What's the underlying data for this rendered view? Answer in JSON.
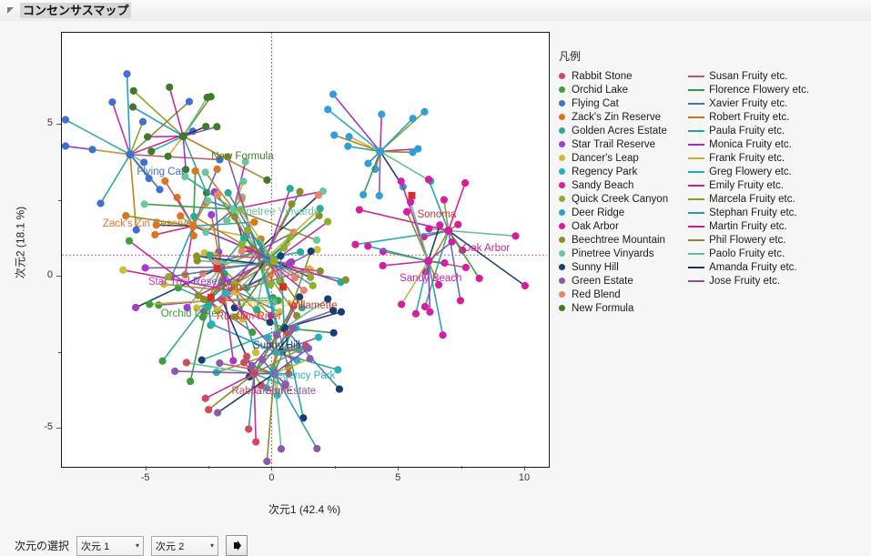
{
  "window": {
    "title": "コンセンサスマップ",
    "disclosure_icon": "triangle-collapse-icon"
  },
  "legend": {
    "title": "凡例",
    "products": [
      {
        "label": "Rabbit Stone",
        "color": "#cf4a5c"
      },
      {
        "label": "Orchid Lake",
        "color": "#3d9e3d"
      },
      {
        "label": "Flying Cat",
        "color": "#3f6fd0"
      },
      {
        "label": "Zack's Zin Reserve",
        "color": "#d9761f"
      },
      {
        "label": "Golden Acres Estate",
        "color": "#2aab94"
      },
      {
        "label": "Star Trail Reserve",
        "color": "#a23bd1"
      },
      {
        "label": "Dancer's Leap",
        "color": "#cdbb3c"
      },
      {
        "label": "Regency Park",
        "color": "#26b0be"
      },
      {
        "label": "Sandy Beach",
        "color": "#d51ea8"
      },
      {
        "label": "Quick Creek Canyon",
        "color": "#8fae2b"
      },
      {
        "label": "Deer Ridge",
        "color": "#2f9fd6"
      },
      {
        "label": "Oak Arbor",
        "color": "#d61e9b"
      },
      {
        "label": "Beechtree Mountain",
        "color": "#8a8f27"
      },
      {
        "label": "Pinetree Vinyards",
        "color": "#68c79c"
      },
      {
        "label": "Sunny Hill",
        "color": "#153f72"
      },
      {
        "label": "Green Estate",
        "color": "#8a5ba8"
      },
      {
        "label": "Red Blend",
        "color": "#e8866c"
      },
      {
        "label": "New Formula",
        "color": "#3f7a29"
      }
    ],
    "attributes": [
      {
        "label": "Susan Fruity etc.",
        "color": "#c0566a"
      },
      {
        "label": "Florence Flowery etc.",
        "color": "#2e9b3f"
      },
      {
        "label": "Xavier Fruity etc.",
        "color": "#4472b8"
      },
      {
        "label": "Robert Fruity etc.",
        "color": "#c07a1e"
      },
      {
        "label": "Paula Fruity etc.",
        "color": "#22a692"
      },
      {
        "label": "Monica Fruity etc.",
        "color": "#9b2fc7"
      },
      {
        "label": "Frank Fruity etc.",
        "color": "#c2b032"
      },
      {
        "label": "Greg Flowery etc.",
        "color": "#1fa9b4"
      },
      {
        "label": "Emily Fruity etc.",
        "color": "#c820a0"
      },
      {
        "label": "Marcela Fruity etc.",
        "color": "#8a9c22"
      },
      {
        "label": "Stephan Fruity etc.",
        "color": "#2296c4"
      },
      {
        "label": "Martin Fruity etc.",
        "color": "#cc1f92"
      },
      {
        "label": "Phil Flowery etc.",
        "color": "#7f8a25"
      },
      {
        "label": "Paolo Fruity etc.",
        "color": "#5cbf95"
      },
      {
        "label": "Amanda Fruity etc.",
        "color": "#16365f"
      },
      {
        "label": "Jose Fruity etc.",
        "color": "#7f53a0"
      }
    ]
  },
  "controls": {
    "label": "次元の選択",
    "dim1": "次元 1",
    "dim2": "次元 2",
    "chevron": "▼",
    "go_button_icon": "right-arrow-icon"
  },
  "chart_data": {
    "type": "scatter",
    "title": "コンセンサスマップ",
    "xlabel": "次元1  (42.4 %)",
    "ylabel": "次元2  (18.1 %)",
    "xticks": [
      -5,
      0,
      5,
      10
    ],
    "yticks": [
      5,
      0,
      -5
    ],
    "xlim": [
      -8.3,
      10.9
    ],
    "ylim": [
      -6.9,
      7.3
    ],
    "grid": false,
    "reference_lines": {
      "x": 0,
      "y": 0,
      "color": "#c06070",
      "style": "dotted"
    },
    "legend_position": "right",
    "point_labels": [
      {
        "text": "New Formula",
        "x": -2.6,
        "y": 3.85,
        "color": "#3f7a29"
      },
      {
        "text": "Flying Cat",
        "x": -5.55,
        "y": 3.35,
        "color": "#3f6fd0"
      },
      {
        "text": "Pinetree Vinyards",
        "x": -1.6,
        "y": 2.05,
        "color": "#68c79c"
      },
      {
        "text": "Zack's Zin Reserve",
        "x": -6.9,
        "y": 1.65,
        "color": "#d9761f"
      },
      {
        "text": "Star Trail Reserve",
        "x": -5.1,
        "y": -0.25,
        "color": "#a23bd1"
      },
      {
        "text": "Napa",
        "x": -2.15,
        "y": -0.45,
        "color": "#cf3333"
      },
      {
        "text": "Orchid Lake",
        "x": -4.6,
        "y": -1.3,
        "color": "#3d9e3d"
      },
      {
        "text": "Dancer's Leap",
        "x": -1.6,
        "y": -0.95,
        "color": "#cdbb3c"
      },
      {
        "text": "Russian River",
        "x": -2.4,
        "y": -1.4,
        "color": "#cf3333"
      },
      {
        "text": "Red Blend",
        "x": -0.45,
        "y": 0.05,
        "color": "#e8866c"
      },
      {
        "text": "Willamette",
        "x": 0.45,
        "y": -1.05,
        "color": "#cf3333"
      },
      {
        "text": "Sunny Hill",
        "x": -0.95,
        "y": -2.35,
        "color": "#153f72"
      },
      {
        "text": "Regency Park",
        "x": -0.3,
        "y": -3.35,
        "color": "#26b0be"
      },
      {
        "text": "Rabbit Stone",
        "x": -1.8,
        "y": -3.85,
        "color": "#cf4a5c"
      },
      {
        "text": "Green Estate",
        "x": -0.9,
        "y": -3.85,
        "color": "#8a5ba8"
      },
      {
        "text": "Sonoma",
        "x": 5.55,
        "y": 1.95,
        "color": "#cf3333"
      },
      {
        "text": "Oak Arbor",
        "x": 7.35,
        "y": 0.85,
        "color": "#d61e9b"
      },
      {
        "text": "Sandy Beach",
        "x": 4.85,
        "y": -0.15,
        "color": "#d51ea8"
      }
    ],
    "clusters": [
      {
        "product": "Flying Cat",
        "color": "#3f6fd0",
        "cx": -5.6,
        "cy": 3.3,
        "n": 14
      },
      {
        "product": "New Formula",
        "color": "#3f7a29",
        "cx": -3.5,
        "cy": 3.9,
        "n": 13
      },
      {
        "product": "Zack's Zin Reserve",
        "color": "#d9761f",
        "cx": -3.1,
        "cy": 0.95,
        "n": 16
      },
      {
        "product": "Star Trail Reserve",
        "color": "#a23bd1",
        "cx": -2.0,
        "cy": -0.4,
        "n": 14
      },
      {
        "product": "Pinetree Vinyards",
        "color": "#68c79c",
        "cx": -1.5,
        "cy": 1.5,
        "n": 13
      },
      {
        "product": "Orchid Lake",
        "color": "#3d9e3d",
        "cx": -2.5,
        "cy": -1.5,
        "n": 15
      },
      {
        "product": "Dancer's Leap",
        "color": "#cdbb3c",
        "cx": -1.4,
        "cy": -1.2,
        "n": 15
      },
      {
        "product": "Red Blend",
        "color": "#e8866c",
        "cx": -0.6,
        "cy": 0.1,
        "n": 12
      },
      {
        "product": "Beechtree Mountain",
        "color": "#8a8f27",
        "cx": -0.4,
        "cy": -0.3,
        "n": 13
      },
      {
        "product": "Golden Acres Estate",
        "color": "#2aab94",
        "cx": -0.2,
        "cy": -0.1,
        "n": 14
      },
      {
        "product": "Quick Creek Canyon",
        "color": "#8fae2b",
        "cx": 0.1,
        "cy": -0.2,
        "n": 13
      },
      {
        "product": "Sunny Hill",
        "color": "#153f72",
        "cx": 0.5,
        "cy": -2.4,
        "n": 15
      },
      {
        "product": "Regency Park",
        "color": "#26b0be",
        "cx": 0.2,
        "cy": -3.2,
        "n": 14
      },
      {
        "product": "Rabbit Stone",
        "color": "#cf4a5c",
        "cx": -0.7,
        "cy": -3.9,
        "n": 14
      },
      {
        "product": "Green Estate",
        "color": "#8a5ba8",
        "cx": 0.1,
        "cy": -3.9,
        "n": 13
      },
      {
        "product": "Deer Ridge",
        "color": "#2f9fd6",
        "cx": 4.3,
        "cy": 3.4,
        "n": 16
      },
      {
        "product": "Oak Arbor",
        "color": "#d61e9b",
        "cx": 7.0,
        "cy": 0.8,
        "n": 15
      },
      {
        "product": "Sandy Beach",
        "color": "#d51ea8",
        "cx": 6.2,
        "cy": -0.2,
        "n": 15
      }
    ]
  }
}
